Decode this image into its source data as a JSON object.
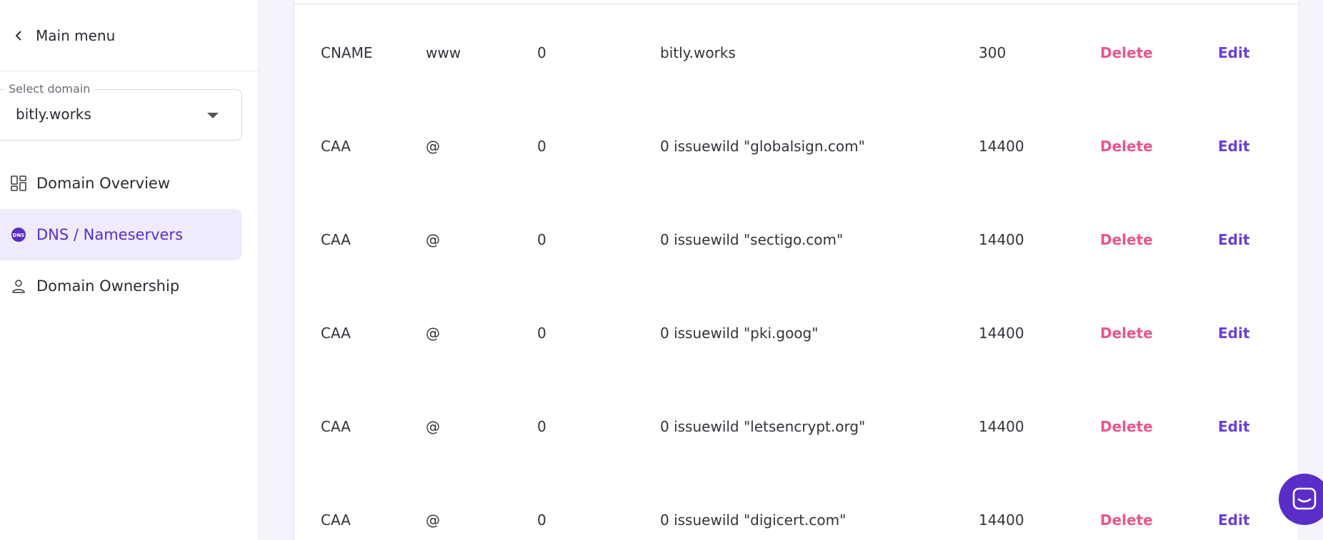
{
  "sidebar": {
    "main_menu": "Main menu",
    "select": {
      "label": "Select domain",
      "value": "bitly.works"
    },
    "items": [
      {
        "label": "Domain Overview",
        "icon": "grid-icon"
      },
      {
        "label": "DNS / Nameservers",
        "icon": "dns-icon",
        "active": true
      },
      {
        "label": "Domain Ownership",
        "icon": "user-icon"
      }
    ]
  },
  "records": [
    {
      "type": "CNAME",
      "name": "www",
      "priority": "0",
      "content": "bitly.works",
      "ttl": "300",
      "delete": "Delete",
      "edit": "Edit"
    },
    {
      "type": "CAA",
      "name": "@",
      "priority": "0",
      "content": "0 issuewild \"globalsign.com\"",
      "ttl": "14400",
      "delete": "Delete",
      "edit": "Edit"
    },
    {
      "type": "CAA",
      "name": "@",
      "priority": "0",
      "content": "0 issuewild \"sectigo.com\"",
      "ttl": "14400",
      "delete": "Delete",
      "edit": "Edit"
    },
    {
      "type": "CAA",
      "name": "@",
      "priority": "0",
      "content": "0 issuewild \"pki.goog\"",
      "ttl": "14400",
      "delete": "Delete",
      "edit": "Edit"
    },
    {
      "type": "CAA",
      "name": "@",
      "priority": "0",
      "content": "0 issuewild \"letsencrypt.org\"",
      "ttl": "14400",
      "delete": "Delete",
      "edit": "Edit"
    },
    {
      "type": "CAA",
      "name": "@",
      "priority": "0",
      "content": "0 issuewild \"digicert.com\"",
      "ttl": "14400",
      "delete": "Delete",
      "edit": "Edit"
    }
  ],
  "colors": {
    "accent": "#5a2dc8",
    "delete": "#e8558c",
    "edit": "#6a3fd6",
    "active_bg": "#efebfc"
  },
  "chat": {
    "icon": "chat-icon"
  }
}
